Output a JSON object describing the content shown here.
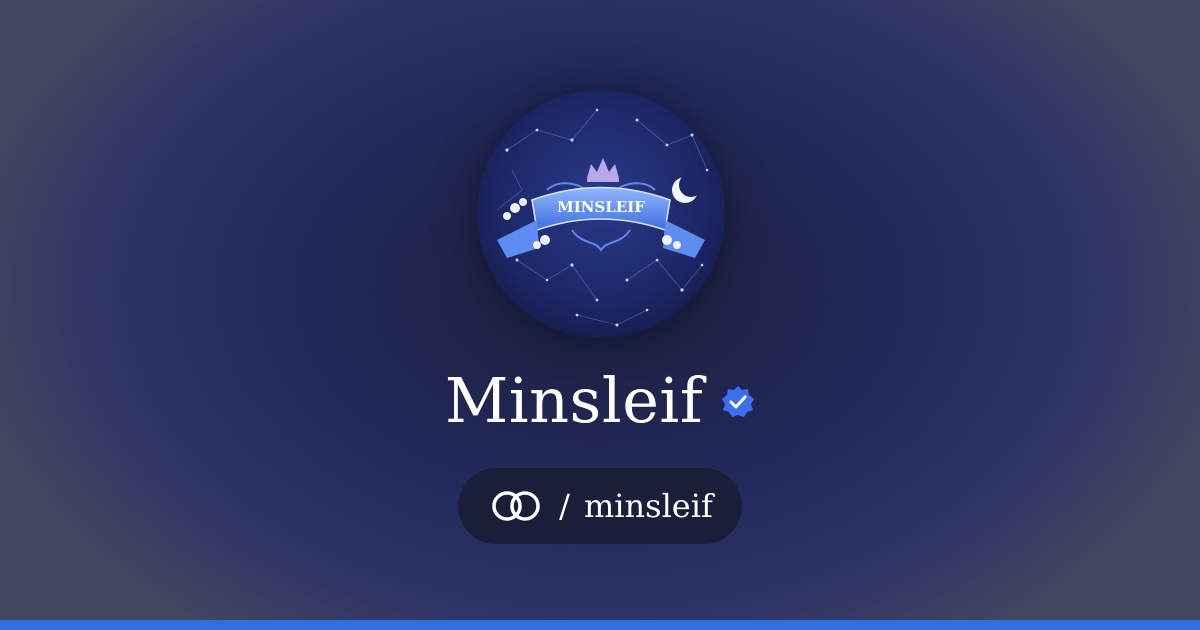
{
  "profile": {
    "display_name": "Minsleif",
    "verified": true,
    "handle": "minsleif",
    "separator": "/",
    "avatar_banner_text": "MINSLEIF"
  },
  "icons": {
    "verified": "verified-badge-icon",
    "platform": "linked-rings-logo-icon"
  },
  "colors": {
    "accent": "#2f6fe0",
    "verified_badge": "#3b6ff0",
    "pill_background": "#1b1e38"
  }
}
